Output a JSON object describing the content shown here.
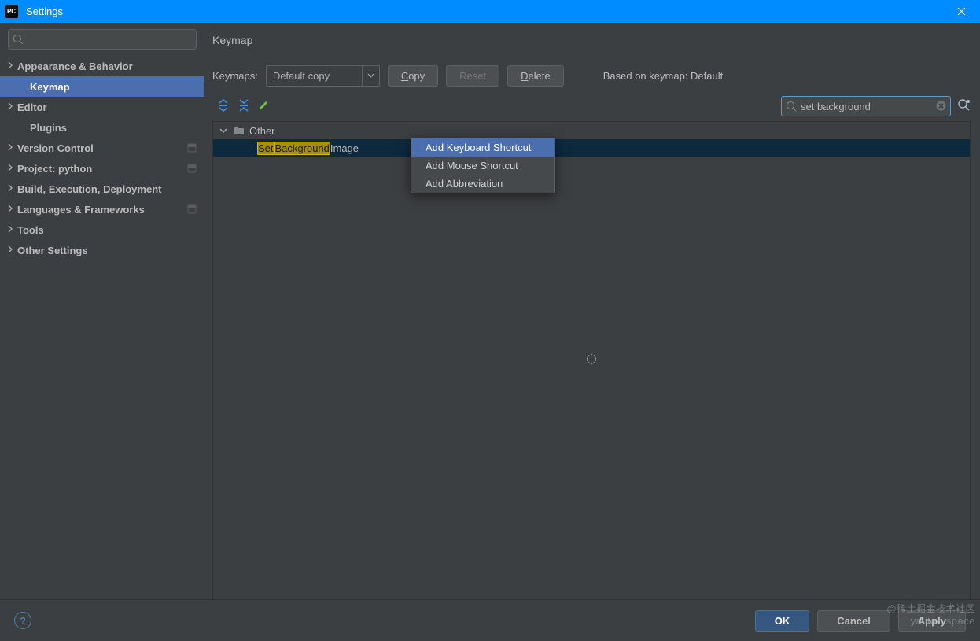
{
  "window": {
    "title": "Settings",
    "logo": "PC"
  },
  "sidebar": {
    "search_placeholder": "",
    "items": [
      {
        "label": "Appearance & Behavior",
        "expandable": true,
        "child": false
      },
      {
        "label": "Keymap",
        "expandable": false,
        "child": true,
        "selected": true
      },
      {
        "label": "Editor",
        "expandable": true,
        "child": false
      },
      {
        "label": "Plugins",
        "expandable": false,
        "child": true
      },
      {
        "label": "Version Control",
        "expandable": true,
        "child": false,
        "badge": true
      },
      {
        "label": "Project: python",
        "expandable": true,
        "child": false,
        "badge": true
      },
      {
        "label": "Build, Execution, Deployment",
        "expandable": true,
        "child": false
      },
      {
        "label": "Languages & Frameworks",
        "expandable": true,
        "child": false,
        "badge": true
      },
      {
        "label": "Tools",
        "expandable": true,
        "child": false
      },
      {
        "label": "Other Settings",
        "expandable": true,
        "child": false
      }
    ]
  },
  "panel": {
    "title": "Keymap",
    "keymaps_label": "Keymaps:",
    "keymaps_value": "Default copy",
    "copy_btn": "Copy",
    "copy_u": "C",
    "reset_btn": "Reset",
    "delete_btn": "Delete",
    "delete_u": "D",
    "based_on": "Based on keymap: Default",
    "search_value": "set background",
    "group_label": "Other",
    "leaf": {
      "h1": "Set",
      "m": " ",
      "h2": "Background",
      "t": " Image"
    }
  },
  "context_menu": {
    "items": [
      "Add Keyboard Shortcut",
      "Add Mouse Shortcut",
      "Add Abbreviation"
    ]
  },
  "footer": {
    "help": "?",
    "ok": "OK",
    "cancel": "Cancel",
    "apply": "Apply"
  },
  "watermark": {
    "l1": "@稀土掘金技术社区",
    "l2": "yalitao.space"
  }
}
